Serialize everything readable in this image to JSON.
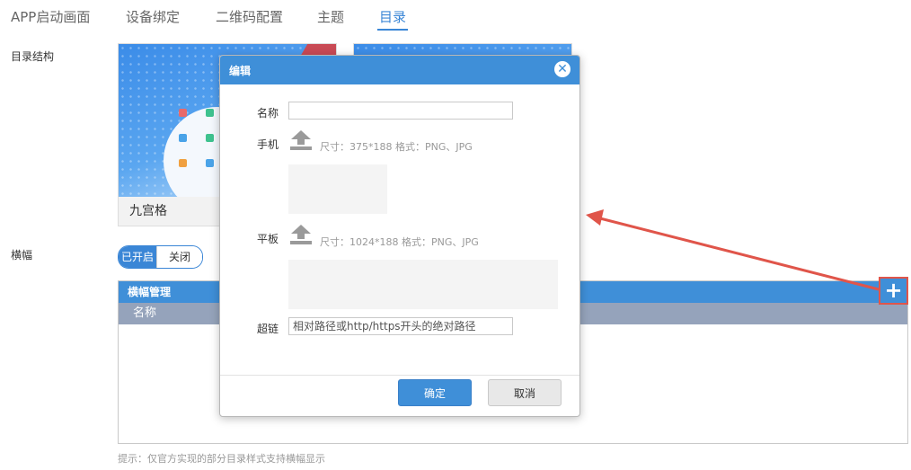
{
  "tabs": [
    {
      "label": "APP启动画面"
    },
    {
      "label": "设备绑定"
    },
    {
      "label": "二维码配置"
    },
    {
      "label": "主题"
    },
    {
      "label": "目录"
    }
  ],
  "active_tab": "目录",
  "directory_structure": {
    "label": "目录结构",
    "cards": [
      {
        "caption": "九宫格"
      }
    ]
  },
  "banner": {
    "label": "横幅",
    "toggle": {
      "on_label": "已开启",
      "off_label": "关闭",
      "selected": "已开启"
    },
    "manager": {
      "title": "横幅管理",
      "columns": [
        "名称"
      ],
      "add_icon": "plus-icon"
    },
    "hint": "提示：仅官方实现的部分目录样式支持横幅显示"
  },
  "modal": {
    "title": "编辑",
    "fields": {
      "name_label": "名称",
      "name_value": "",
      "phone_label": "手机",
      "phone_hint": "尺寸：375*188 格式：PNG、JPG",
      "tablet_label": "平板",
      "tablet_hint": "尺寸：1024*188 格式：PNG、JPG",
      "link_label": "超链",
      "link_placeholder": "相对路径或http/https开头的绝对路径"
    },
    "confirm_label": "确定",
    "cancel_label": "取消",
    "close_icon": "close-icon",
    "upload_icon": "upload-icon"
  },
  "colors": {
    "accent": "#3a86d6",
    "header_blue": "#3f8fd8",
    "column_header": "#95a3bb",
    "annotation": "#e0554a"
  }
}
